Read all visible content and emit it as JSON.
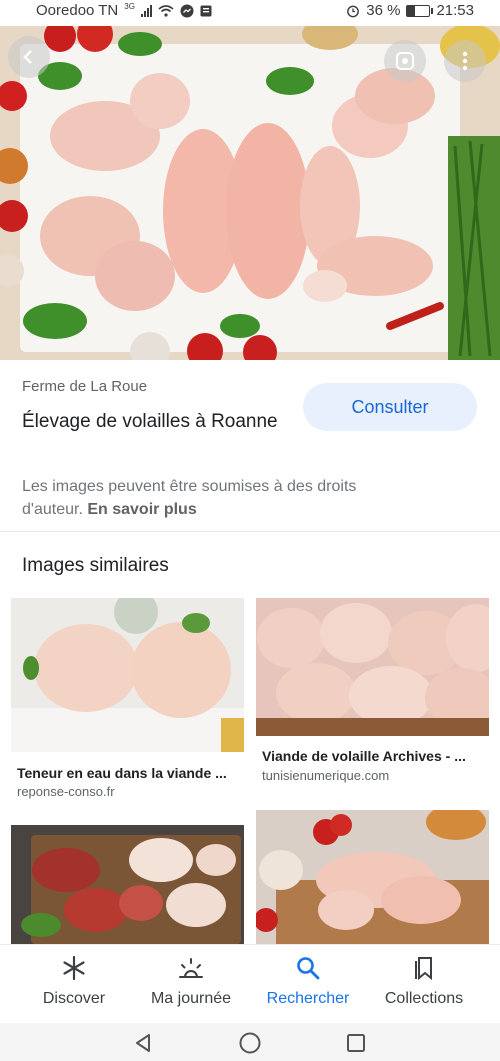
{
  "status": {
    "carrier": "Ooredoo TN",
    "network": "3G",
    "battery": "36 %",
    "battery_level": 0.36,
    "time": "21:53"
  },
  "result": {
    "source": "Ferme de La Roue",
    "title": "Élevage de volailles à Roanne",
    "action_label": "Consulter",
    "rights_text": "Les images peuvent être soumises à des droits d'auteur.",
    "learn_more": "En savoir plus"
  },
  "similar": {
    "heading": "Images similaires",
    "items": [
      {
        "title": "Teneur en eau dans la viande ...",
        "source": "reponse-conso.fr"
      },
      {
        "title": "Viande de volaille Archives - ...",
        "source": "tunisienumerique.com"
      },
      {
        "title": "",
        "source": ""
      },
      {
        "title": "",
        "source": ""
      }
    ]
  },
  "bottom_nav": {
    "items": [
      {
        "label": "Discover",
        "icon": "asterisk-icon"
      },
      {
        "label": "Ma journée",
        "icon": "sunrise-icon"
      },
      {
        "label": "Rechercher",
        "icon": "search-icon",
        "active": true
      },
      {
        "label": "Collections",
        "icon": "bookmark-icon"
      }
    ]
  },
  "colors": {
    "accent": "#1a73e8",
    "button_bg": "#e8f0fe"
  }
}
